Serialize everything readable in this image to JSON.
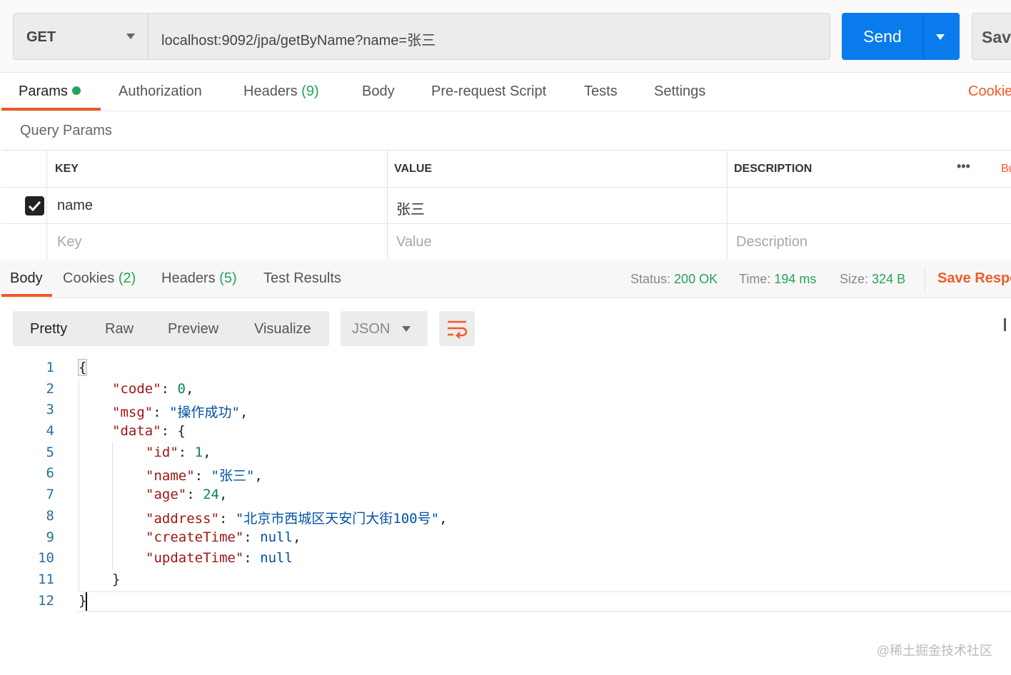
{
  "request": {
    "method": "GET",
    "url": "localhost:9092/jpa/getByName?name=张三",
    "send_label": "Send",
    "save_label": "Save"
  },
  "tabs": {
    "params": "Params",
    "authorization": "Authorization",
    "headers": "Headers",
    "headers_count": "(9)",
    "body": "Body",
    "prerequest": "Pre-request Script",
    "tests": "Tests",
    "settings": "Settings",
    "cookies": "Cookies"
  },
  "query_params": {
    "title": "Query Params",
    "headers": {
      "key": "KEY",
      "value": "VALUE",
      "description": "DESCRIPTION",
      "more": "•••",
      "bulk": "Bulk Edit"
    },
    "rows": [
      {
        "checked": true,
        "key": "name",
        "value": "张三",
        "description": ""
      }
    ],
    "placeholders": {
      "key": "Key",
      "value": "Value",
      "description": "Description"
    }
  },
  "response": {
    "tabs": {
      "body": "Body",
      "cookies": "Cookies",
      "cookies_count": "(2)",
      "headers": "Headers",
      "headers_count": "(5)",
      "test_results": "Test Results"
    },
    "status_label": "Status:",
    "status": "200 OK",
    "time_label": "Time:",
    "time": "194 ms",
    "size_label": "Size:",
    "size": "324 B",
    "save_label": "Save Response"
  },
  "viewer": {
    "modes": [
      "Pretty",
      "Raw",
      "Preview",
      "Visualize"
    ],
    "format": "JSON",
    "wrap_icon": "wrap-lines-icon"
  },
  "code_lines": [
    {
      "n": "1",
      "i": 0,
      "t": [
        [
          "p",
          "{"
        ]
      ]
    },
    {
      "n": "2",
      "i": 1,
      "t": [
        [
          "k",
          "\"code\""
        ],
        [
          "p",
          ": "
        ],
        [
          "n",
          "0"
        ],
        [
          "p",
          ","
        ]
      ]
    },
    {
      "n": "3",
      "i": 1,
      "t": [
        [
          "k",
          "\"msg\""
        ],
        [
          "p",
          ": "
        ],
        [
          "s",
          "\"操作成功\""
        ],
        [
          "p",
          ","
        ]
      ]
    },
    {
      "n": "4",
      "i": 1,
      "t": [
        [
          "k",
          "\"data\""
        ],
        [
          "p",
          ": {"
        ]
      ]
    },
    {
      "n": "5",
      "i": 2,
      "t": [
        [
          "k",
          "\"id\""
        ],
        [
          "p",
          ": "
        ],
        [
          "n",
          "1"
        ],
        [
          "p",
          ","
        ]
      ]
    },
    {
      "n": "6",
      "i": 2,
      "t": [
        [
          "k",
          "\"name\""
        ],
        [
          "p",
          ": "
        ],
        [
          "s",
          "\"张三\""
        ],
        [
          "p",
          ","
        ]
      ]
    },
    {
      "n": "7",
      "i": 2,
      "t": [
        [
          "k",
          "\"age\""
        ],
        [
          "p",
          ": "
        ],
        [
          "n",
          "24"
        ],
        [
          "p",
          ","
        ]
      ]
    },
    {
      "n": "8",
      "i": 2,
      "t": [
        [
          "k",
          "\"address\""
        ],
        [
          "p",
          ": "
        ],
        [
          "s",
          "\"北京市西城区天安门大街100号\""
        ],
        [
          "p",
          ","
        ]
      ]
    },
    {
      "n": "9",
      "i": 2,
      "t": [
        [
          "k",
          "\"createTime\""
        ],
        [
          "p",
          ": "
        ],
        [
          "s",
          "null"
        ],
        [
          "p",
          ","
        ]
      ]
    },
    {
      "n": "10",
      "i": 2,
      "t": [
        [
          "k",
          "\"updateTime\""
        ],
        [
          "p",
          ": "
        ],
        [
          "s",
          "null"
        ]
      ]
    },
    {
      "n": "11",
      "i": 1,
      "t": [
        [
          "p",
          "}"
        ]
      ]
    },
    {
      "n": "12",
      "i": 0,
      "t": [
        [
          "p",
          "}"
        ]
      ]
    }
  ],
  "watermark": "@稀土掘金技术社区",
  "colors": {
    "accent": "#f05a28",
    "send": "#097bed",
    "success": "#26a25a"
  }
}
